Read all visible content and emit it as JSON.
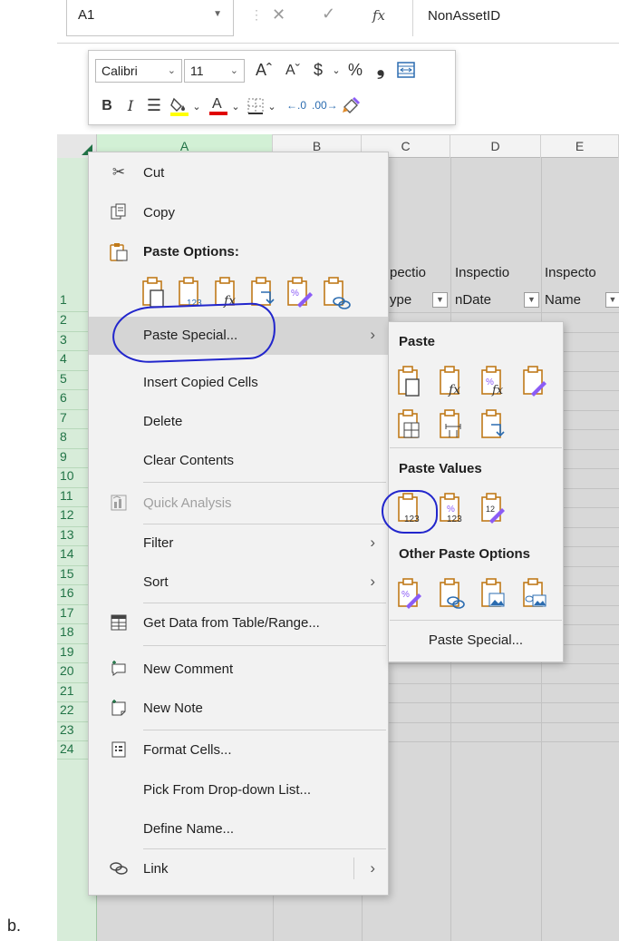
{
  "name_box": {
    "value": "A1"
  },
  "formula_bar": {
    "fx_label": "fx",
    "value": "NonAssetID"
  },
  "mini_toolbar": {
    "font_name": "Calibri",
    "font_size": "11",
    "increase_font": "Aˆ",
    "decrease_font": "Aˇ",
    "currency": "$",
    "percent": "%",
    "comma": "➉",
    "bold": "B",
    "italic": "I"
  },
  "columns": [
    {
      "label": "A",
      "selected": true
    },
    {
      "label": "B",
      "selected": false
    },
    {
      "label": "C",
      "selected": false
    },
    {
      "label": "D",
      "selected": false
    },
    {
      "label": "E",
      "selected": false
    }
  ],
  "rows": [
    "1",
    "2",
    "3",
    "4",
    "5",
    "6",
    "7",
    "8",
    "9",
    "10",
    "11",
    "12",
    "13",
    "14",
    "15",
    "16",
    "17",
    "18",
    "19",
    "20",
    "21",
    "22",
    "23",
    "24"
  ],
  "header_cells": {
    "c_top": "pectio",
    "c_bottom": "ype",
    "d_top": "Inspectio",
    "d_bottom": "nDate",
    "e_top": "Inspecto",
    "e_bottom": "Name"
  },
  "context_menu": {
    "cut": "Cut",
    "copy": "Copy",
    "paste_options": "Paste Options:",
    "paste_special": "Paste Special...",
    "insert_copied_cells": "Insert Copied Cells",
    "delete": "Delete",
    "clear_contents": "Clear Contents",
    "quick_analysis": "Quick Analysis",
    "filter": "Filter",
    "sort": "Sort",
    "get_data": "Get Data from Table/Range...",
    "new_comment": "New Comment",
    "new_note": "New Note",
    "format_cells": "Format Cells...",
    "pick_from_list": "Pick From Drop-down List...",
    "define_name": "Define Name...",
    "link": "Link"
  },
  "submenu": {
    "paste_header": "Paste",
    "paste_values_header": "Paste Values",
    "other_paste_header": "Other Paste Options",
    "paste_special": "Paste Special..."
  },
  "caption": "b.",
  "colors": {
    "excel_green": "#217346",
    "annotation_blue": "#2226cc",
    "paste_orange": "#c07a1a"
  }
}
